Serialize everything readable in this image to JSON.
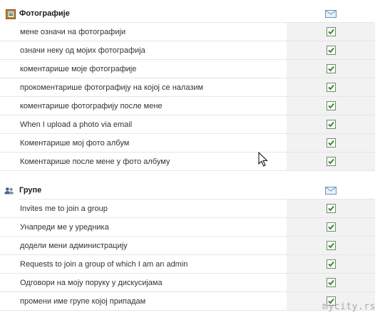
{
  "sections": [
    {
      "title": "Фотографије",
      "icon": "photo-album-icon",
      "column_icon": "envelope-icon",
      "rows": [
        {
          "label": "мене означи на фотографији",
          "checked": true
        },
        {
          "label": "означи неку од мојих фотографија",
          "checked": true
        },
        {
          "label": "коментарише моје фотографије",
          "checked": true
        },
        {
          "label": "прокоментарише фотографију на којој се налазим",
          "checked": true
        },
        {
          "label": "коментарише фотографију после мене",
          "checked": true
        },
        {
          "label": "When I upload a photo via email",
          "checked": true
        },
        {
          "label": "Коментарише мој фото албум",
          "checked": true
        },
        {
          "label": "Коментарише после мене у фото албуму",
          "checked": true
        }
      ]
    },
    {
      "title": "Групе",
      "icon": "group-people-icon",
      "column_icon": "envelope-icon",
      "rows": [
        {
          "label": "Invites me to join a group",
          "checked": true
        },
        {
          "label": "Унапреди ме у уредника",
          "checked": true
        },
        {
          "label": "додели мени администрацију",
          "checked": true
        },
        {
          "label": "Requests to join a group of which I am an admin",
          "checked": true
        },
        {
          "label": "Одговори на моју поруку у дискусијама",
          "checked": true
        },
        {
          "label": "промени име групе којој припадам",
          "checked": true
        }
      ]
    }
  ],
  "watermark": "mycity.rs",
  "colors": {
    "check": "#3a8a2a",
    "cell_bg": "#f2f2f2",
    "envelope": "#6b8fc4"
  }
}
